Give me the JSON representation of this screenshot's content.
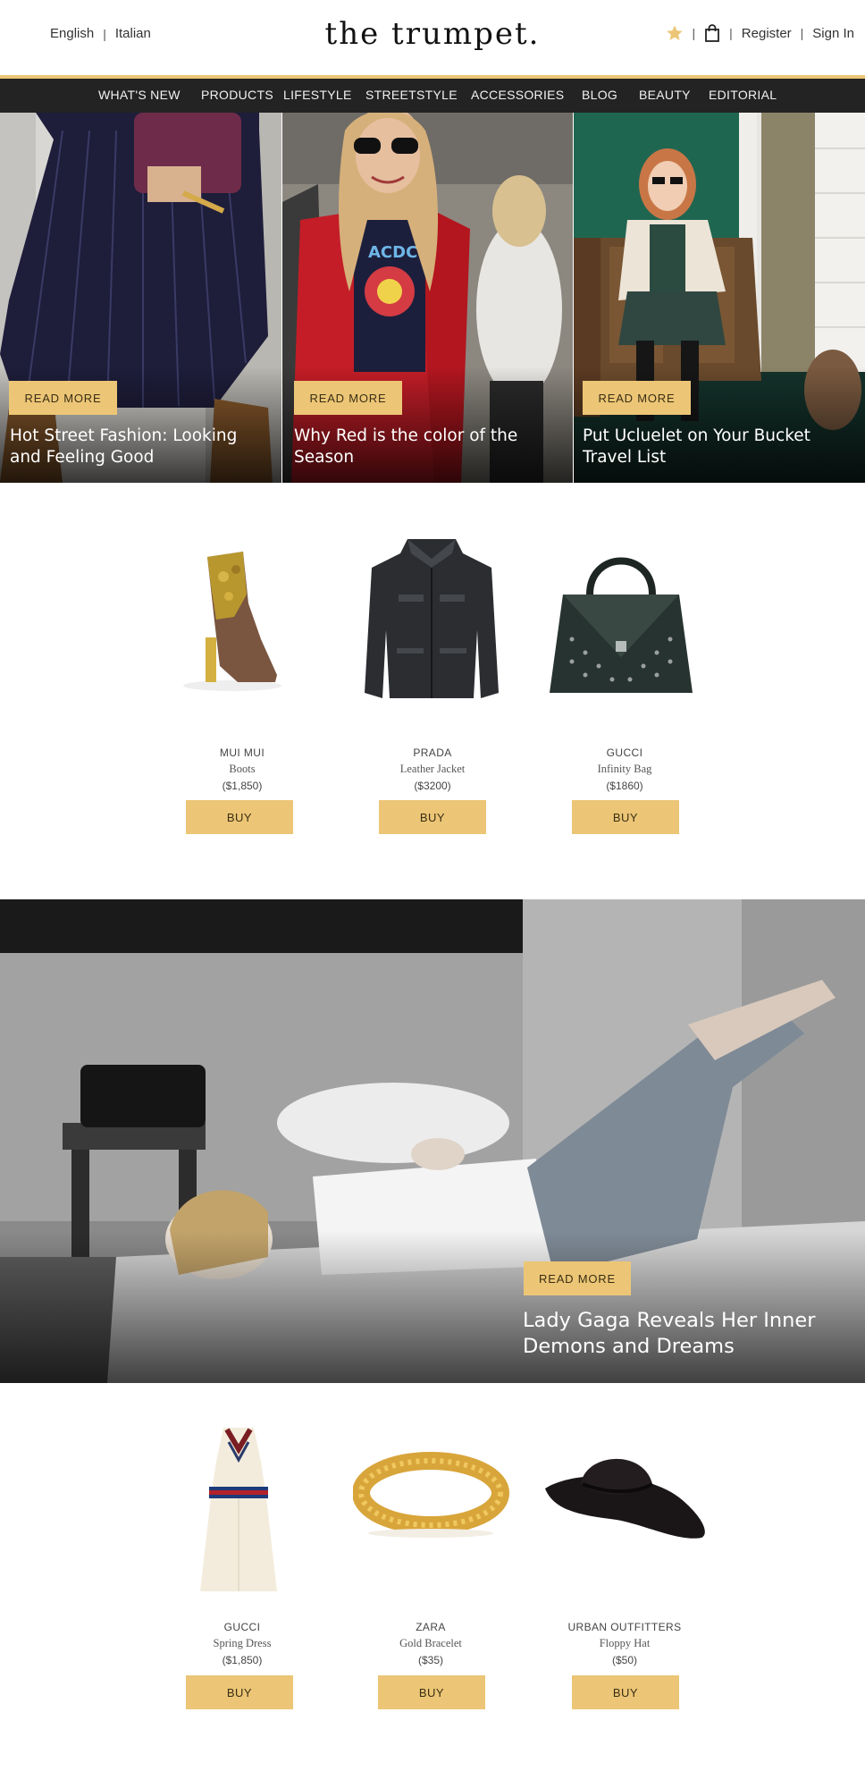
{
  "header": {
    "languages": [
      "English",
      "Italian"
    ],
    "logo": "the trumpet.",
    "register": "Register",
    "sign_in": "Sign In",
    "icons": [
      "star-icon",
      "shopping-bag-icon"
    ],
    "accent_color": "#ecc676"
  },
  "nav": {
    "items": [
      "WHAT'S NEW",
      "PRODUCTS",
      "LIFESTYLE",
      "STREETSTYLE",
      "ACCESSORIES",
      "BLOG",
      "BEAUTY",
      "EDITORIAL"
    ]
  },
  "hero": [
    {
      "button": "READ MORE",
      "title": "Hot Street Fashion: Looking and Feeling Good"
    },
    {
      "button": "READ MORE",
      "title": "Why Red is the color of the Season"
    },
    {
      "button": "READ MORE",
      "title": "Put Ucluelet on Your Bucket Travel List"
    }
  ],
  "products_top": [
    {
      "brand": "MUI MUI",
      "name": "Boots",
      "price": "($1,850)",
      "button": "BUY"
    },
    {
      "brand": "PRADA",
      "name": "Leather Jacket",
      "price": "($3200)",
      "button": "BUY"
    },
    {
      "brand": "GUCCI",
      "name": "Infinity Bag",
      "price": "($1860)",
      "button": "BUY"
    }
  ],
  "feature": {
    "button": "READ MORE",
    "title": "Lady Gaga Reveals Her Inner Demons and Dreams"
  },
  "products_bottom": [
    {
      "brand": "GUCCI",
      "name": "Spring Dress",
      "price": "($1,850)",
      "button": "BUY"
    },
    {
      "brand": "ZARA",
      "name": "Gold Bracelet",
      "price": "($35)",
      "button": "BUY"
    },
    {
      "brand": "URBAN OUTFITTERS",
      "name": "Floppy Hat",
      "price": "($50)",
      "button": "BUY"
    }
  ]
}
